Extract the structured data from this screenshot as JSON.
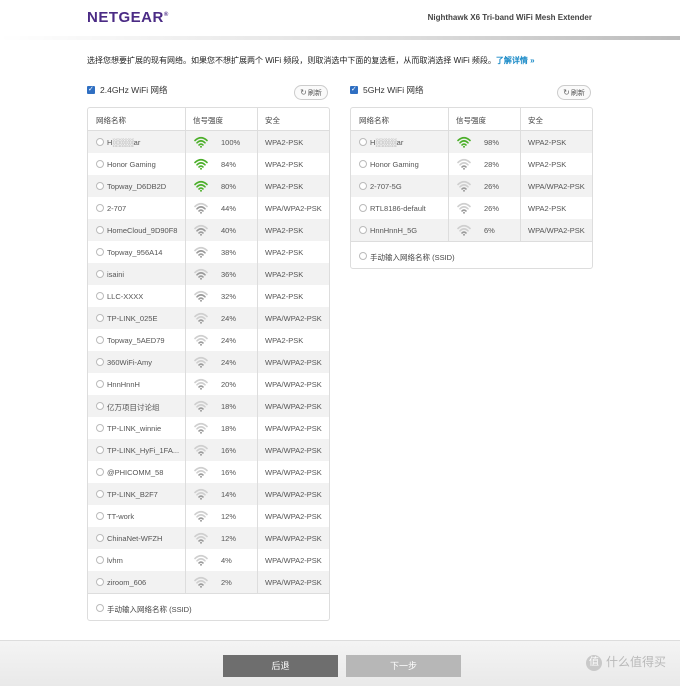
{
  "header": {
    "logo": "NETGEAR",
    "logo_mark": "®",
    "product": "Nighthawk X6 Tri-band WiFi Mesh Extender"
  },
  "intro": {
    "text": "选择您想要扩展的现有网络。如果您不想扩展两个 WiFi 频段，则取消选中下面的复选框，从而取消选择 WiFi 频段。",
    "link": "了解详情 »"
  },
  "columns": {
    "name": "网络名称",
    "signal": "信号强度",
    "security": "安全"
  },
  "refresh_label": "刷新",
  "manual_label": "手动输入网络名称 (SSID)",
  "colors": {
    "signal_strong": "#4caf2a",
    "signal_weak": "#9a9a9a",
    "accent": "#2f6fc2",
    "brand": "#4b2b85"
  },
  "band24": {
    "title": "2.4GHz WiFi 网络",
    "networks": [
      {
        "name": "H░░░░ar",
        "signal": 100,
        "signal_label": "100%",
        "security": "WPA2-PSK"
      },
      {
        "name": "Honor Gaming",
        "signal": 84,
        "signal_label": "84%",
        "security": "WPA2-PSK"
      },
      {
        "name": "Topway_D6DB2D",
        "signal": 80,
        "signal_label": "80%",
        "security": "WPA2-PSK"
      },
      {
        "name": "2-707",
        "signal": 44,
        "signal_label": "44%",
        "security": "WPA/WPA2-PSK"
      },
      {
        "name": "HomeCloud_9D90F8",
        "signal": 40,
        "signal_label": "40%",
        "security": "WPA2-PSK"
      },
      {
        "name": "Topway_956A14",
        "signal": 38,
        "signal_label": "38%",
        "security": "WPA2-PSK"
      },
      {
        "name": "isaini",
        "signal": 36,
        "signal_label": "36%",
        "security": "WPA2-PSK"
      },
      {
        "name": "LLC-XXXX",
        "signal": 32,
        "signal_label": "32%",
        "security": "WPA2-PSK"
      },
      {
        "name": "TP-LINK_025E",
        "signal": 24,
        "signal_label": "24%",
        "security": "WPA/WPA2-PSK"
      },
      {
        "name": "Topway_5AED79",
        "signal": 24,
        "signal_label": "24%",
        "security": "WPA2-PSK"
      },
      {
        "name": "360WiFi-Amy",
        "signal": 24,
        "signal_label": "24%",
        "security": "WPA/WPA2-PSK"
      },
      {
        "name": "HnnHnnH",
        "signal": 20,
        "signal_label": "20%",
        "security": "WPA/WPA2-PSK"
      },
      {
        "name": "亿万项目讨论组",
        "signal": 18,
        "signal_label": "18%",
        "security": "WPA/WPA2-PSK"
      },
      {
        "name": "TP-LINK_winnie",
        "signal": 18,
        "signal_label": "18%",
        "security": "WPA/WPA2-PSK"
      },
      {
        "name": "TP-LINK_HyFi_1FA...",
        "signal": 16,
        "signal_label": "16%",
        "security": "WPA/WPA2-PSK"
      },
      {
        "name": "@PHICOMM_58",
        "signal": 16,
        "signal_label": "16%",
        "security": "WPA/WPA2-PSK"
      },
      {
        "name": "TP-LINK_B2F7",
        "signal": 14,
        "signal_label": "14%",
        "security": "WPA/WPA2-PSK"
      },
      {
        "name": "TT-work",
        "signal": 12,
        "signal_label": "12%",
        "security": "WPA/WPA2-PSK"
      },
      {
        "name": "ChinaNet-WFZH",
        "signal": 12,
        "signal_label": "12%",
        "security": "WPA/WPA2-PSK"
      },
      {
        "name": "lvhm",
        "signal": 4,
        "signal_label": "4%",
        "security": "WPA/WPA2-PSK"
      },
      {
        "name": "ziroom_606",
        "signal": 2,
        "signal_label": "2%",
        "security": "WPA/WPA2-PSK"
      }
    ]
  },
  "band5": {
    "title": "5GHz WiFi 网络",
    "networks": [
      {
        "name": "H░░░░ar",
        "signal": 98,
        "signal_label": "98%",
        "security": "WPA2-PSK"
      },
      {
        "name": "Honor Gaming",
        "signal": 28,
        "signal_label": "28%",
        "security": "WPA2-PSK"
      },
      {
        "name": "2-707-5G",
        "signal": 26,
        "signal_label": "26%",
        "security": "WPA/WPA2-PSK"
      },
      {
        "name": "RTL8186-default",
        "signal": 26,
        "signal_label": "26%",
        "security": "WPA2-PSK"
      },
      {
        "name": "HnnHnnH_5G",
        "signal": 6,
        "signal_label": "6%",
        "security": "WPA/WPA2-PSK"
      }
    ]
  },
  "footer": {
    "back_label": "后退",
    "next_label": "下一步",
    "watermark": "什么值得买",
    "watermark_badge": "值"
  }
}
